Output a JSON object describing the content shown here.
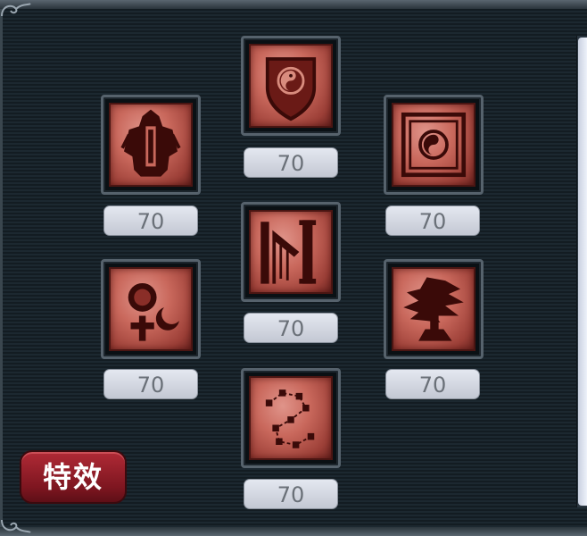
{
  "skills": [
    {
      "id": "shield-taiji",
      "icon": "shield-taiji-icon",
      "level": "70"
    },
    {
      "id": "armor-totem",
      "icon": "armor-totem-icon",
      "level": "70"
    },
    {
      "id": "seal-taiji",
      "icon": "seal-taiji-icon",
      "level": "70"
    },
    {
      "id": "slash-pillar",
      "icon": "slash-pillar-icon",
      "level": "70"
    },
    {
      "id": "sun-moon-cross",
      "icon": "sun-moon-cross-icon",
      "level": "70"
    },
    {
      "id": "pine-tree",
      "icon": "pine-tree-icon",
      "level": "70"
    },
    {
      "id": "constellation",
      "icon": "constellation-icon",
      "level": "70"
    }
  ],
  "effects_button": {
    "label": "特效"
  },
  "colors": {
    "tile": "#c9685c",
    "tile_dark": "#4a1512",
    "button": "#9a1e2a",
    "level_text": "#6a7078"
  }
}
